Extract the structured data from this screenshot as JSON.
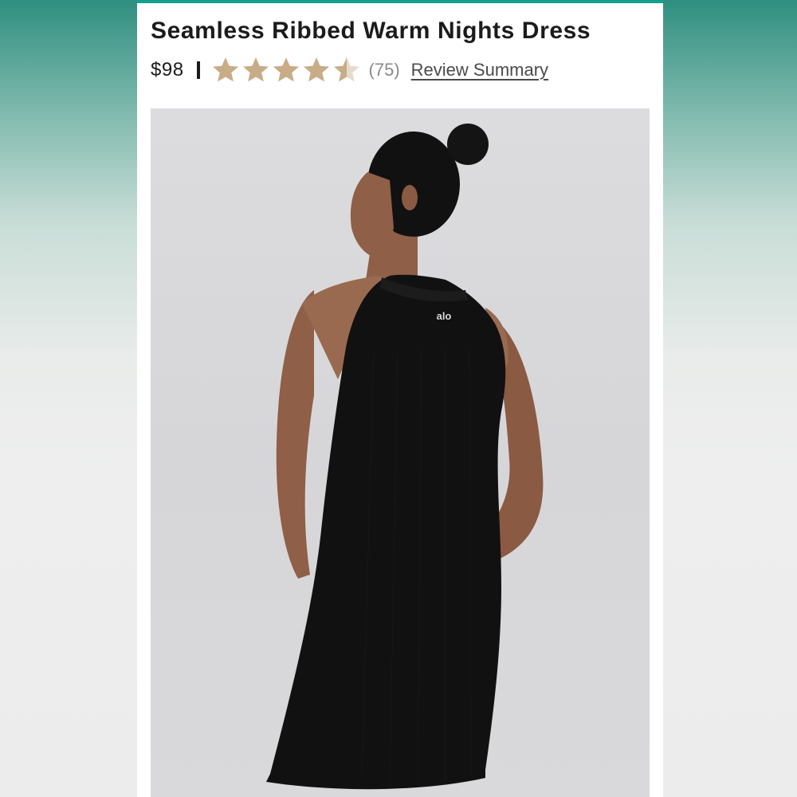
{
  "product": {
    "title": "Seamless Ribbed Warm Nights Dress",
    "price": "$98",
    "rating": 4.5,
    "rating_max": 5,
    "review_count": "(75)",
    "review_link": "Review Summary",
    "logo_text": "alo"
  },
  "colors": {
    "accent": "#14a08d",
    "star_fill": "#c8ac88",
    "star_empty": "#e6dccd",
    "dress": "#111111",
    "skin": "#9a6a50"
  },
  "icons": {
    "star": "star-icon",
    "half_star": "half-star-icon"
  }
}
